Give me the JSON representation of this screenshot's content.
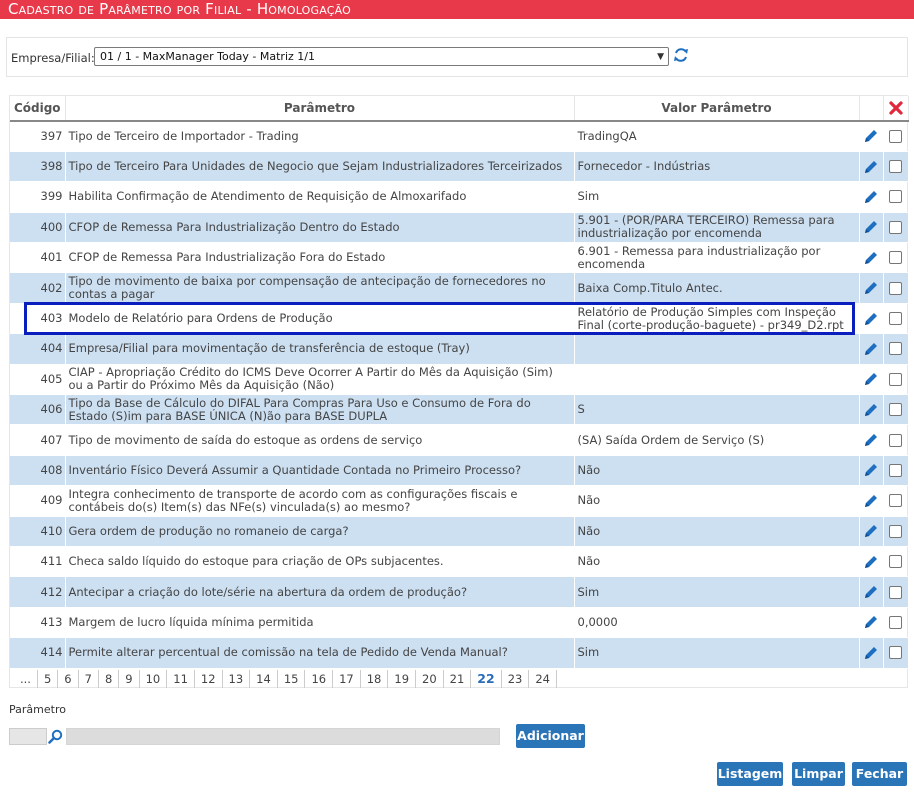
{
  "window": {
    "title": "Cadastro de Parâmetro por Filial  - Homologação"
  },
  "filter": {
    "label": "Empresa/Filial:",
    "value": "01 / 1 - MaxManager Today - Matriz 1/1"
  },
  "table": {
    "headers": {
      "code": "Código",
      "param": "Parâmetro",
      "value": "Valor Parâmetro"
    },
    "rows": [
      {
        "code": "397",
        "param": "Tipo de Terceiro de Importador - Trading",
        "value": "TradingQA"
      },
      {
        "code": "398",
        "param": "Tipo de Terceiro Para Unidades de Negocio que Sejam Industrializadores Terceirizados",
        "value": "Fornecedor - Indústrias"
      },
      {
        "code": "399",
        "param": "Habilita Confirmação de Atendimento de Requisição de Almoxarifado",
        "value": "Sim"
      },
      {
        "code": "400",
        "param": "CFOP de Remessa Para Industrialização Dentro do Estado",
        "value": "5.901 - (POR/PARA TERCEIRO) Remessa para industrialização por encomenda"
      },
      {
        "code": "401",
        "param": "CFOP de Remessa Para Industrialização Fora do Estado",
        "value": "6.901 - Remessa para industrialização por encomenda"
      },
      {
        "code": "402",
        "param": "Tipo de movimento de baixa por compensação de antecipação de fornecedores no contas a pagar",
        "value": "Baixa Comp.Titulo Antec."
      },
      {
        "code": "403",
        "param": "Modelo de Relatório para Ordens de Produção",
        "value": "Relatório de Produção Simples com Inspeção Final (corte-produção-baguete) - pr349_D2.rpt"
      },
      {
        "code": "404",
        "param": "Empresa/Filial para movimentação de transferência de estoque (Tray)",
        "value": ""
      },
      {
        "code": "405",
        "param": "CIAP - Apropriação Crédito do ICMS Deve Ocorrer A Partir do Mês da Aquisição (Sim) ou a Partir do Próximo Mês da Aquisição (Não)",
        "value": ""
      },
      {
        "code": "406",
        "param": "Tipo da Base de Cálculo do DIFAL Para Compras Para Uso e Consumo de Fora do Estado (S)im para BASE ÚNICA (N)ão para BASE DUPLA",
        "value": "S"
      },
      {
        "code": "407",
        "param": "Tipo de movimento de saída do estoque as ordens de serviço",
        "value": "(SA) Saída Ordem de Serviço (S)"
      },
      {
        "code": "408",
        "param": "Inventário Físico Deverá Assumir a Quantidade Contada no Primeiro Processo?",
        "value": "Não"
      },
      {
        "code": "409",
        "param": "Integra conhecimento de transporte de acordo com as configurações fiscais e contábeis do(s) Item(s) das NFe(s) vinculada(s) ao mesmo?",
        "value": "Não"
      },
      {
        "code": "410",
        "param": "Gera ordem de produção no romaneio de carga?",
        "value": "Não"
      },
      {
        "code": "411",
        "param": "Checa saldo líquido do estoque para criação de OPs subjacentes.",
        "value": "Não"
      },
      {
        "code": "412",
        "param": "Antecipar a criação do lote/série na abertura da ordem de produção?",
        "value": "Sim"
      },
      {
        "code": "413",
        "param": "Margem de lucro líquida mínima permitida",
        "value": "0,0000"
      },
      {
        "code": "414",
        "param": "Permite alterar percentual de comissão na tela de Pedido de Venda Manual?",
        "value": "Sim"
      }
    ]
  },
  "pager": {
    "pages": [
      "...",
      "5",
      "6",
      "7",
      "8",
      "9",
      "10",
      "11",
      "12",
      "13",
      "14",
      "15",
      "16",
      "17",
      "18",
      "19",
      "20",
      "21",
      "22",
      "23",
      "24"
    ],
    "current": "22"
  },
  "form": {
    "param_label": "Parâmetro",
    "add_label": "Adicionar"
  },
  "footer": {
    "listagem_label": "Listagem",
    "limpar_label": "Limpar",
    "fechar_label": "Fechar"
  },
  "colors": {
    "title_bar": "#e8394a",
    "row_alt": "#cde0f2",
    "button": "#2a74b8",
    "highlight": "#0a1ebe",
    "icon_blue": "#1f6fc1"
  },
  "icons": {
    "refresh": "refresh-icon",
    "delete": "delete-x-icon",
    "edit": "pencil-icon",
    "search": "search-icon"
  }
}
